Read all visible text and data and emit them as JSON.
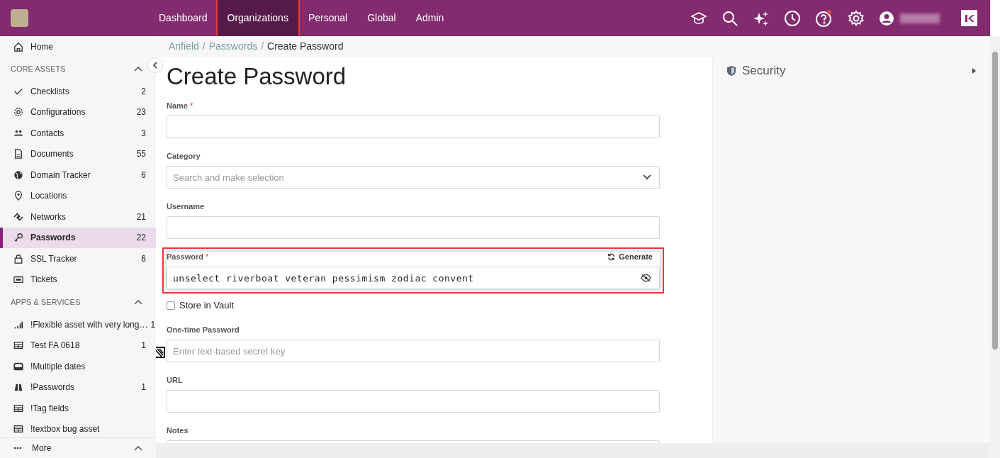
{
  "nav": [
    {
      "label": "Dashboard",
      "selected": false,
      "highlighted": false
    },
    {
      "label": "Organizations",
      "selected": true,
      "highlighted": true
    },
    {
      "label": "Personal",
      "selected": false,
      "highlighted": false
    },
    {
      "label": "Global",
      "selected": false,
      "highlighted": false
    },
    {
      "label": "Admin",
      "selected": false,
      "highlighted": false
    }
  ],
  "sidebar": {
    "home": "Home",
    "sections": [
      {
        "title": "CORE ASSETS",
        "expanded": true,
        "items": [
          {
            "kind": "check",
            "label": "Checklists",
            "count": "2",
            "selected": false
          },
          {
            "kind": "gear",
            "label": "Configurations",
            "count": "23",
            "selected": false
          },
          {
            "kind": "people",
            "label": "Contacts",
            "count": "3",
            "selected": false
          },
          {
            "kind": "doc",
            "label": "Documents",
            "count": "55",
            "selected": false
          },
          {
            "kind": "globe",
            "label": "Domain Tracker",
            "count": "6",
            "selected": false
          },
          {
            "kind": "pin",
            "label": "Locations",
            "selected": false
          },
          {
            "kind": "network",
            "label": "Networks",
            "count": "21",
            "selected": false
          },
          {
            "kind": "key",
            "label": "Passwords",
            "count": "22",
            "selected": true
          },
          {
            "kind": "lock",
            "label": "SSL Tracker",
            "count": "6",
            "selected": false
          },
          {
            "kind": "ticket",
            "label": "Tickets",
            "selected": false
          }
        ]
      },
      {
        "title": "APPS & SERVICES",
        "expanded": true,
        "items": [
          {
            "kind": "bars",
            "label": "!Flexible asset with very long…",
            "count": "1",
            "selected": false
          },
          {
            "kind": "table",
            "label": "Test FA 0618",
            "count": "1",
            "selected": false
          },
          {
            "kind": "inbox",
            "label": "!Multiple dates",
            "selected": false
          },
          {
            "kind": "binoculars",
            "label": "!Passwords",
            "count": "1",
            "selected": false
          },
          {
            "kind": "table",
            "label": "!Tag fields",
            "selected": false
          },
          {
            "kind": "table",
            "label": "!textbox bug asset",
            "selected": false
          }
        ]
      }
    ],
    "more": "More"
  },
  "breadcrumb": [
    {
      "label": "Anfield",
      "separator": "/"
    },
    {
      "label": "Passwords",
      "separator": "/"
    },
    {
      "label": "Create Password"
    }
  ],
  "title": "Create Password",
  "fields": [
    {
      "kind": "text",
      "label": "Name",
      "required_mark": "*"
    },
    {
      "kind": "select",
      "label": "Category",
      "placeholder": "Search and make selection"
    },
    {
      "kind": "text",
      "label": "Username"
    },
    {
      "kind": "password",
      "label": "Password",
      "required_mark": "*",
      "value": "unselect riverboat veteran pessimism zodiac convent",
      "action": "Generate",
      "highlighted": true
    },
    {
      "kind": "checkbox",
      "label": "Store in Vault",
      "checked": false
    },
    {
      "kind": "text",
      "label": "One-time Password",
      "placeholder": "Enter text-based secret key"
    },
    {
      "kind": "text",
      "label": "URL"
    },
    {
      "kind": "text",
      "label": "Notes"
    }
  ],
  "side_panel": {
    "title": "Security"
  }
}
